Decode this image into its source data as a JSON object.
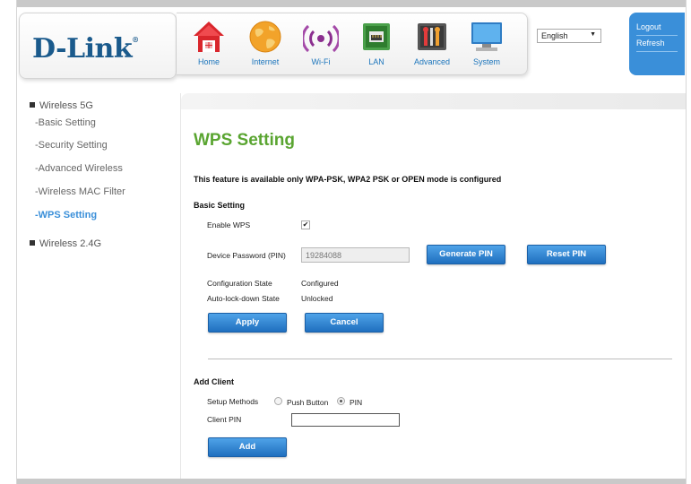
{
  "header": {
    "logo_text": "D-Link",
    "nav": [
      {
        "label": "Home",
        "icon": "home-icon"
      },
      {
        "label": "Internet",
        "icon": "globe-icon"
      },
      {
        "label": "Wi-Fi",
        "icon": "wifi-icon"
      },
      {
        "label": "LAN",
        "icon": "lan-port-icon"
      },
      {
        "label": "Advanced",
        "icon": "tools-icon"
      },
      {
        "label": "System",
        "icon": "monitor-icon"
      }
    ],
    "language": "English",
    "logout_label": "Logout",
    "refresh_label": "Refresh"
  },
  "sidebar": {
    "section_5g": "Wireless 5G",
    "items": [
      {
        "label": "-Basic Setting"
      },
      {
        "label": "-Security Setting"
      },
      {
        "label": "-Advanced Wireless"
      },
      {
        "label": "-Wireless MAC Filter"
      },
      {
        "label": "-WPS Setting"
      }
    ],
    "section_24g": "Wireless 2.4G"
  },
  "main": {
    "title": "WPS Setting",
    "notice": "This feature is available only WPA-PSK, WPA2 PSK or OPEN mode is configured",
    "basic": {
      "heading": "Basic Setting",
      "enable_wps_label": "Enable WPS",
      "enable_wps_checked": true,
      "device_pin_label": "Device Password (PIN)",
      "device_pin_value": "19284088",
      "generate_pin_label": "Generate PIN",
      "reset_pin_label": "Reset PIN",
      "config_state_label": "Configuration State",
      "config_state_value": "Configured",
      "autolock_label": "Auto-lock-down State",
      "autolock_value": "Unlocked",
      "apply_label": "Apply",
      "cancel_label": "Cancel"
    },
    "client": {
      "heading": "Add Client",
      "setup_methods_label": "Setup Methods",
      "push_button_label": "Push Button",
      "pin_label": "PIN",
      "selected_method": "PIN",
      "client_pin_label": "Client PIN",
      "client_pin_value": "",
      "add_label": "Add"
    }
  },
  "colors": {
    "brand_blue": "#1a5a8c",
    "accent_blue": "#3a8fd9",
    "title_green": "#5aa531",
    "button_blue": "#1f6fbf"
  }
}
